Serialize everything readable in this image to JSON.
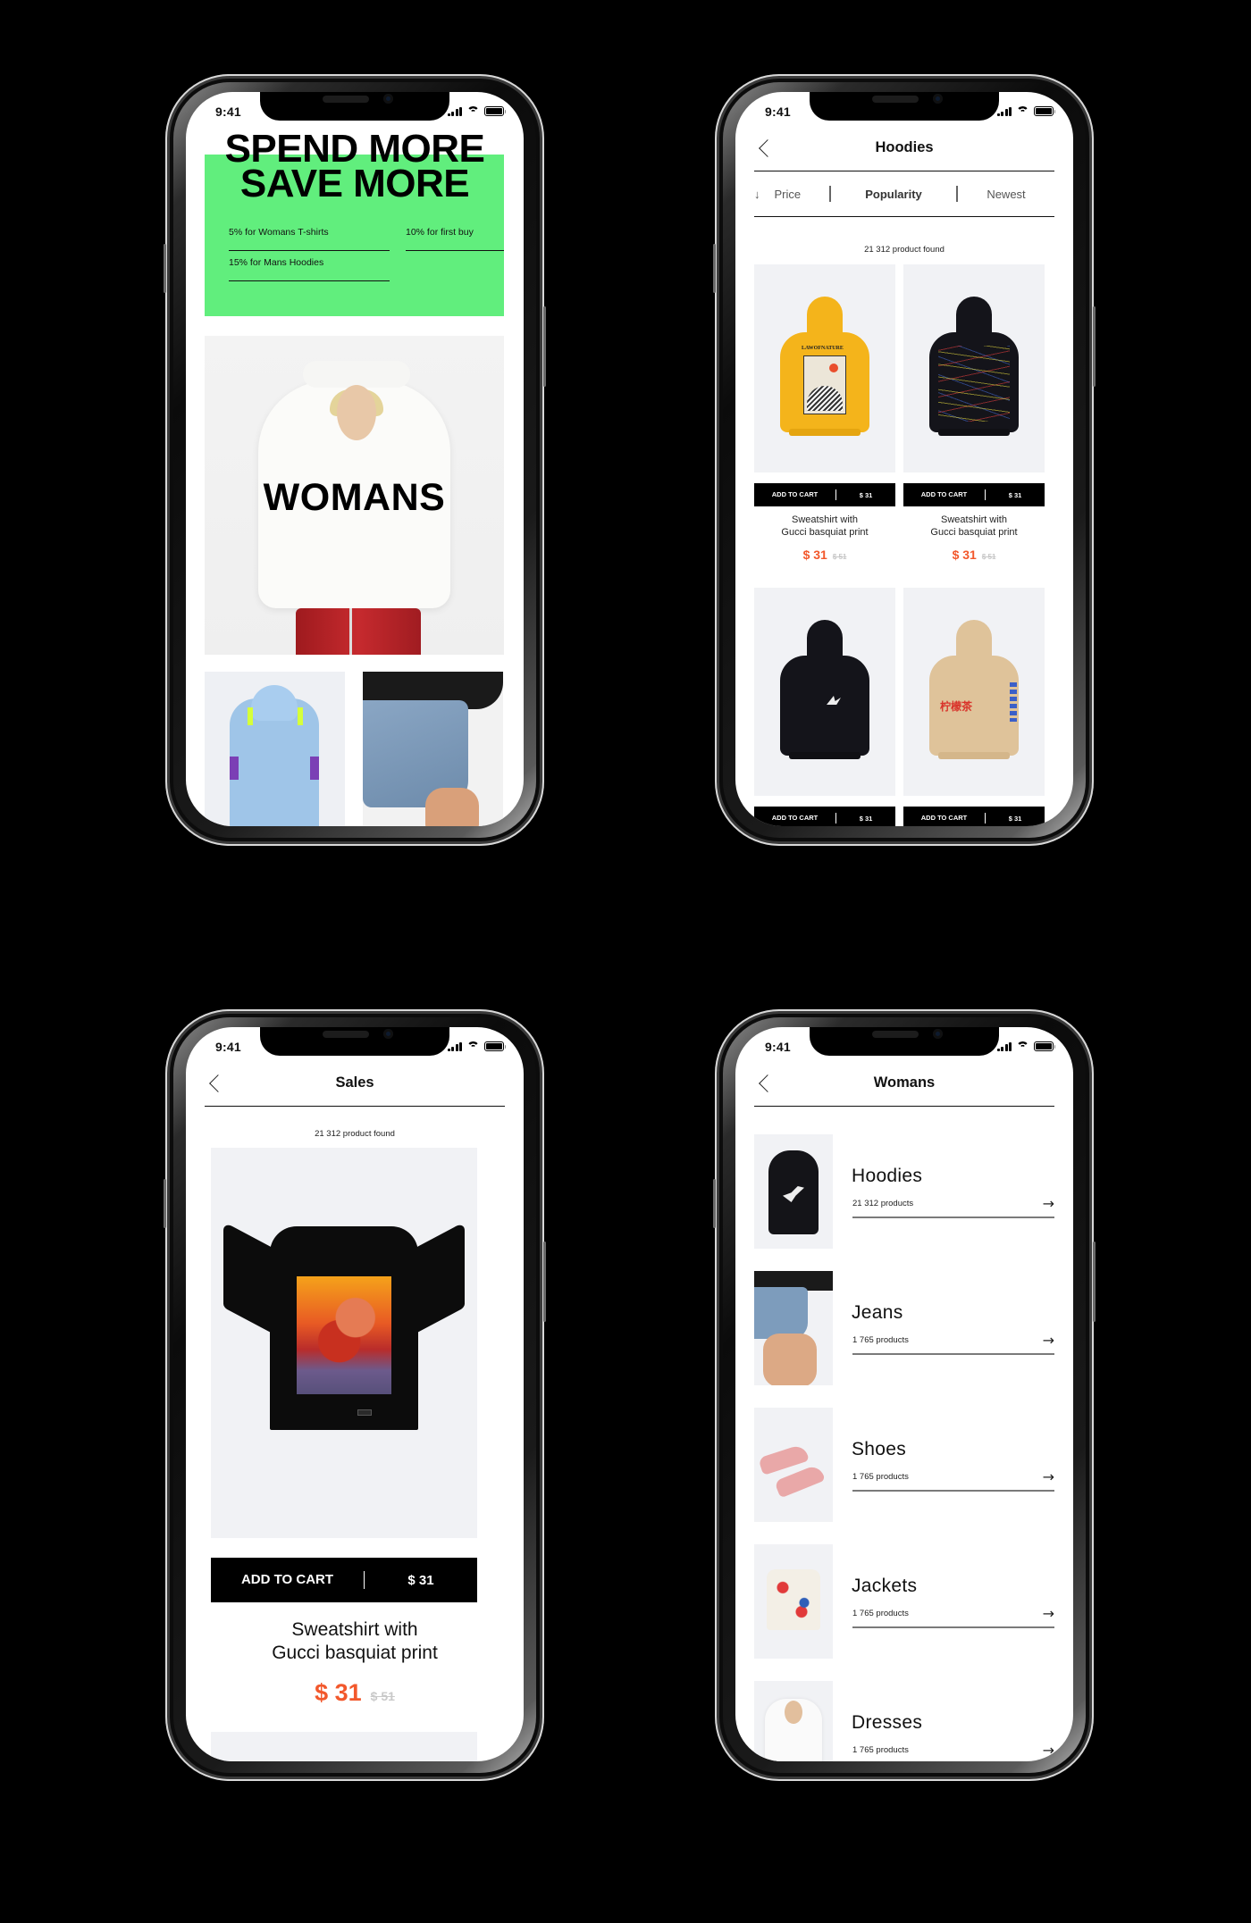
{
  "status_bar": {
    "time": "9:41"
  },
  "screens": {
    "home": {
      "promo": {
        "title_line1": "SPEND MORE",
        "title_line2": "SAVE MORE",
        "offers": [
          "5% for Womans T-shirts",
          "10% for first buy",
          "15% for Mans Hoodies"
        ],
        "background_color": "#61ee7d"
      },
      "hero_label": "WOMANS",
      "tiles": [
        {
          "label": "jacket"
        },
        {
          "label": "jeans"
        }
      ]
    },
    "hoodies": {
      "title": "Hoodies",
      "sort": {
        "arrow": "↓",
        "options": [
          "Price",
          "Popularity",
          "Newest"
        ],
        "active": "Popularity"
      },
      "found_text": "21 312 product found",
      "products": [
        {
          "name_line1": "Sweatshirt with",
          "name_line2": "Gucci basquiat print",
          "price": "$ 31",
          "old_price": "$ 51",
          "cart_label": "ADD TO CART",
          "cart_price": "$ 31",
          "image": "yellow-hoodie"
        },
        {
          "name_line1": "Sweatshirt with",
          "name_line2": "Gucci basquiat print",
          "price": "$ 31",
          "old_price": "$ 51",
          "cart_label": "ADD TO CART",
          "cart_price": "$ 31",
          "image": "black-graffiti-hoodie"
        },
        {
          "cart_label": "ADD TO CART",
          "cart_price": "$ 31",
          "image": "black-crane-hoodie"
        },
        {
          "cart_label": "ADD TO CART",
          "cart_price": "$ 31",
          "image": "beige-hoodie",
          "print_text": "柠檬茶"
        }
      ]
    },
    "sales": {
      "title": "Sales",
      "found_text": "21 312 product found",
      "product": {
        "name_line1": "Sweatshirt with",
        "name_line2": "Gucci basquiat print",
        "price": "$ 31",
        "old_price": "$ 51",
        "cart_label": "ADD TO CART",
        "cart_price": "$ 31"
      }
    },
    "womans": {
      "title": "Womans",
      "categories": [
        {
          "name": "Hoodies",
          "count": "21 312 products"
        },
        {
          "name": "Jeans",
          "count": "1 765 products"
        },
        {
          "name": "Shoes",
          "count": "1 765 products"
        },
        {
          "name": "Jackets",
          "count": "1 765 products"
        },
        {
          "name": "Dresses",
          "count": "1 765 products"
        }
      ],
      "arrow": "→"
    }
  },
  "colors": {
    "accent_price": "#f2582c",
    "promo_green": "#61ee7d",
    "old_price": "#c8c8c8",
    "background": "#000000"
  }
}
